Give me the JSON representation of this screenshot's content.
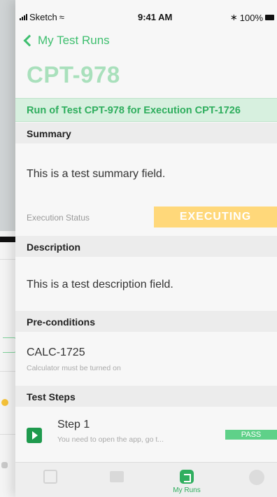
{
  "status_bar": {
    "carrier": "Sketch",
    "time": "9:41 AM",
    "battery": "100%"
  },
  "nav": {
    "back_label": "My Test Runs"
  },
  "header": {
    "key": "CPT-978"
  },
  "run_title": "Run of Test CPT-978 for Execution CPT-1726",
  "summary": {
    "header": "Summary",
    "text": "This is a test summary field."
  },
  "execution_status": {
    "label": "Execution Status",
    "value": "EXECUTING",
    "color": "#ffd87a"
  },
  "description": {
    "header": "Description",
    "text": "This is a test description field."
  },
  "preconditions": {
    "header": "Pre-conditions",
    "key": "CALC-1725",
    "summary": "Calculator must be turned on"
  },
  "test_steps": {
    "header": "Test Steps",
    "steps": [
      {
        "title": "Step 1",
        "summary": "You need to open the app, go t...",
        "status": "PASS"
      }
    ]
  },
  "tab_bar": {
    "active_label": "My Runs"
  },
  "colors": {
    "accent": "#2fae5e",
    "accent_light": "#d7f0df",
    "pass": "#5fd189"
  }
}
